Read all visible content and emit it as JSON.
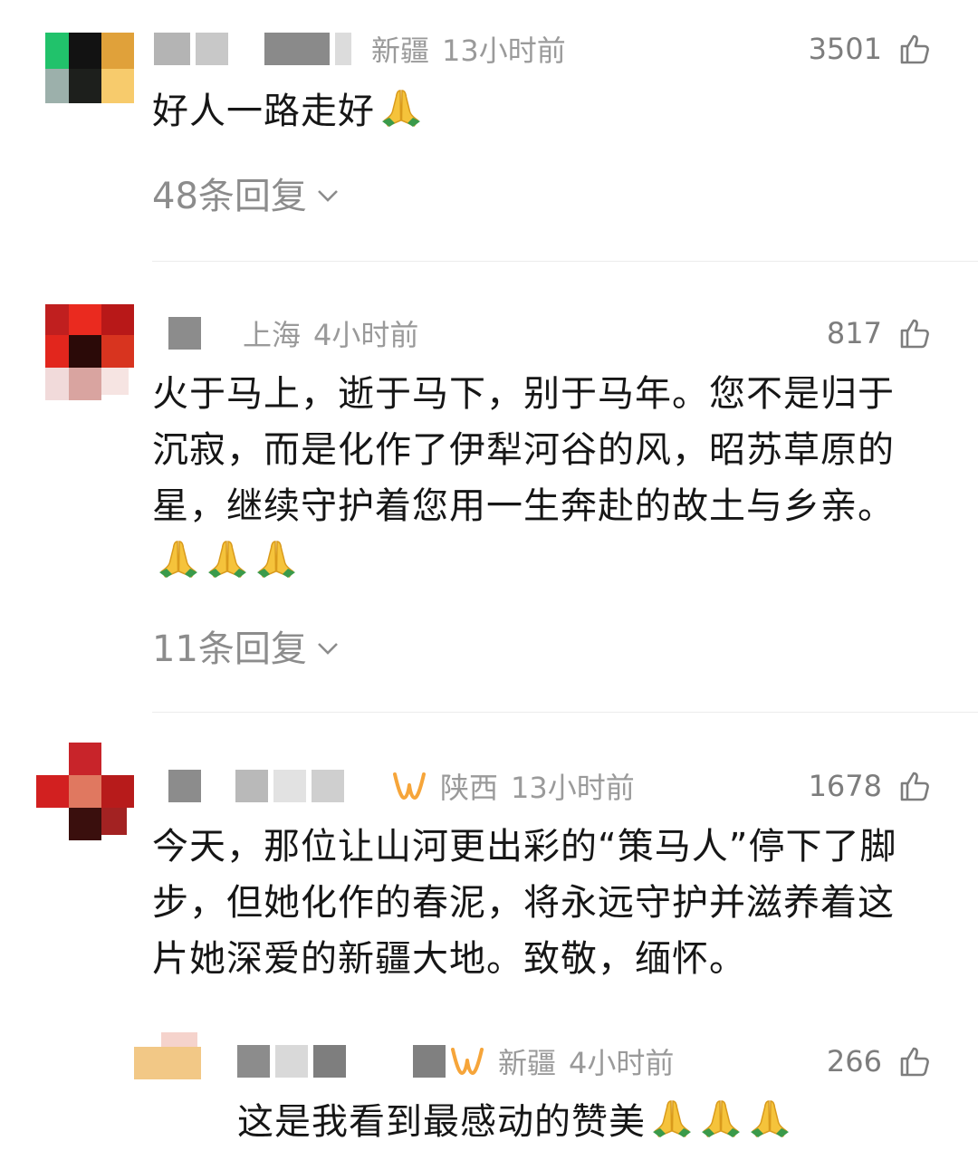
{
  "comments": [
    {
      "location": "新疆",
      "time": "13小时前",
      "likes": "3501",
      "text": "好人一路走好",
      "pray_count": 1,
      "replies": "48条回复"
    },
    {
      "location": "上海",
      "time": "4小时前",
      "likes": "817",
      "text": "火于马上，逝于马下，别于马年。您不是归于沉寂，而是化作了伊犁河谷的风，昭苏草原的星，继续守护着您用一生奔赴的故土与乡亲。",
      "pray_count": 3,
      "replies": "11条回复"
    },
    {
      "location": "陕西",
      "time": "13小时前",
      "likes": "1678",
      "text": "今天，那位让山河更出彩的“策马人”停下了脚步，但她化作的春泥，将永远守护并滋养着这片她深爱的新疆大地。致敬，缅怀。"
    },
    {
      "location": "新疆",
      "time": "4小时前",
      "likes": "266",
      "text": "这是我看到最感动的赞美",
      "pray_count": 3
    }
  ],
  "icons": {
    "like": "thumbs-up-outline-icon",
    "expand": "chevron-down-icon",
    "vip_badge": "orange-w-badge-icon",
    "emoji": "folded-hands-emoji"
  },
  "colors": {
    "meta_gray": "#9a9a9a",
    "text": "#161616",
    "badge_orange": "#f6a53a"
  }
}
